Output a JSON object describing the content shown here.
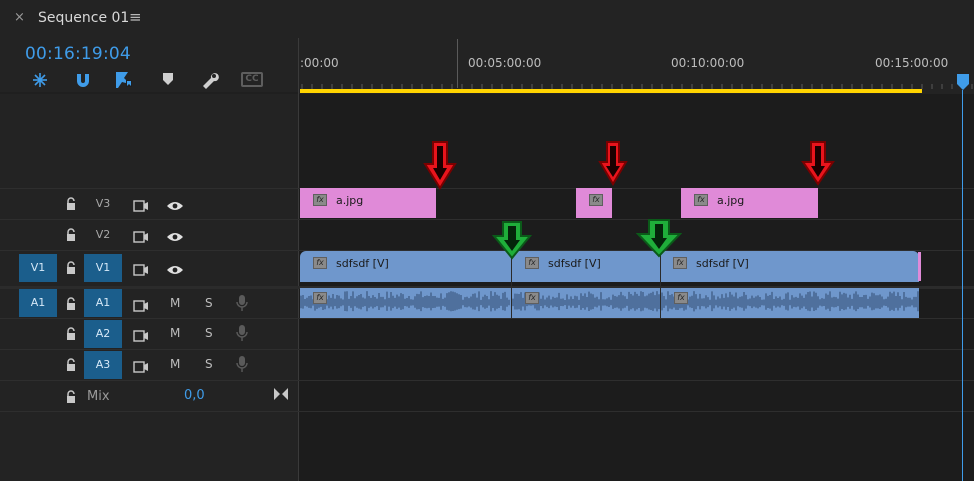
{
  "panel": {
    "close_glyph": "×",
    "title": "Sequence 01",
    "menu_glyph": "≡"
  },
  "timecode": "00:16:19:04",
  "tools": [
    {
      "name": "snap-icon"
    },
    {
      "name": "linked-selection-icon"
    },
    {
      "name": "add-marker-icon"
    },
    {
      "name": "marker-icon"
    },
    {
      "name": "wrench-icon"
    },
    {
      "name": "captions-icon",
      "label": "CC"
    }
  ],
  "ruler": {
    "labels": [
      ":00:00",
      "00:05:00:00",
      "00:10:00:00",
      "00:15:00:00"
    ]
  },
  "tracks": {
    "video": [
      {
        "label": "V3",
        "source_patch": ""
      },
      {
        "label": "V2",
        "source_patch": ""
      },
      {
        "label": "V1",
        "source_patch": "V1"
      }
    ],
    "audio": [
      {
        "label": "A1",
        "source_patch": "A1",
        "mute": "M",
        "solo": "S"
      },
      {
        "label": "A2",
        "source_patch": "",
        "mute": "M",
        "solo": "S"
      },
      {
        "label": "A3",
        "source_patch": "",
        "mute": "M",
        "solo": "S"
      }
    ],
    "mix": {
      "label": "Mix",
      "value": "0,0"
    }
  },
  "clips": {
    "v3": [
      {
        "name": "a.jpg",
        "fx": "fx"
      },
      {
        "name": "",
        "fx": "fx"
      },
      {
        "name": "a.jpg",
        "fx": "fx"
      }
    ],
    "v1": [
      {
        "name": "sdfsdf [V]",
        "fx": "fx"
      },
      {
        "name": "sdfsdf [V]",
        "fx": "fx"
      },
      {
        "name": "sdfsdf [V]",
        "fx": "fx"
      }
    ],
    "a1": [
      {
        "fx": "fx"
      },
      {
        "fx": "fx"
      },
      {
        "fx": "fx"
      }
    ]
  },
  "annotations": {
    "red_arrow_color": "#e8141c",
    "green_arrow_color": "#1fae3a"
  },
  "colors": {
    "accent": "#3f9ce9",
    "work_area": "#ffd400",
    "image_clip": "#e08ad8",
    "video_clip": "#6f97cc",
    "patch": "#1b5e8c"
  }
}
